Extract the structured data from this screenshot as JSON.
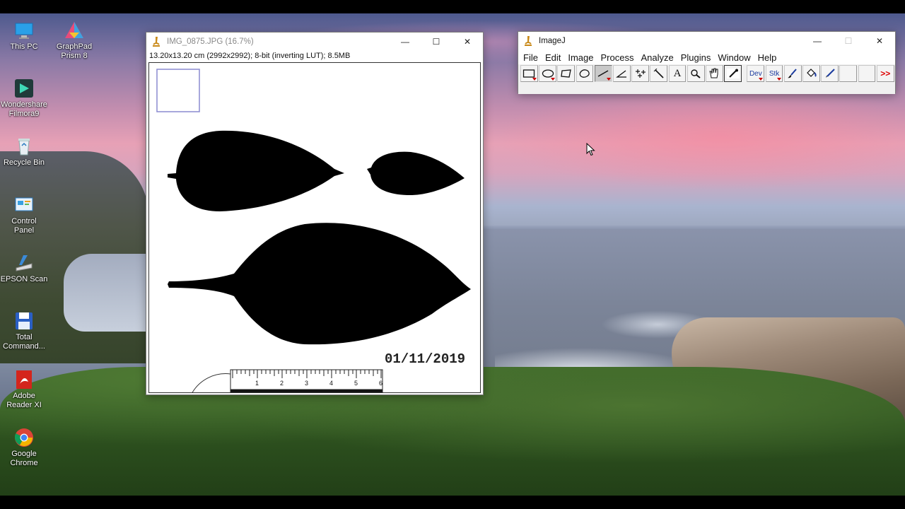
{
  "desktop": {
    "icons": [
      {
        "name": "this-pc",
        "label": "This PC"
      },
      {
        "name": "graphpad-prism",
        "label": "GraphPad\nPrism 8"
      },
      {
        "name": "wondershare-filmora",
        "label": "Wondershare\nFilmora9"
      },
      {
        "name": "recycle-bin",
        "label": "Recycle Bin"
      },
      {
        "name": "control-panel",
        "label": "Control\nPanel"
      },
      {
        "name": "epson-scan",
        "label": "EPSON Scan"
      },
      {
        "name": "total-commander",
        "label": "Total\nCommand..."
      },
      {
        "name": "adobe-reader",
        "label": "Adobe\nReader XI"
      },
      {
        "name": "google-chrome",
        "label": "Google\nChrome"
      }
    ]
  },
  "image_window": {
    "title": "IMG_0875.JPG (16.7%)",
    "info": "13.20x13.20 cm (2992x2992); 8-bit (inverting LUT); 8.5MB",
    "date_stamp": "01/11/2019",
    "ruler_numbers": [
      "1",
      "2",
      "3",
      "4",
      "5",
      "6"
    ],
    "controls": {
      "minimize": "—",
      "maximize": "☐",
      "close": "✕"
    }
  },
  "imagej_window": {
    "title": "ImageJ",
    "menu": [
      "File",
      "Edit",
      "Image",
      "Process",
      "Analyze",
      "Plugins",
      "Window",
      "Help"
    ],
    "tools": [
      {
        "name": "rectangle-tool",
        "icon": "rectangle-icon"
      },
      {
        "name": "oval-tool",
        "icon": "oval-icon"
      },
      {
        "name": "polygon-tool",
        "icon": "polygon-icon"
      },
      {
        "name": "freehand-tool",
        "icon": "freehand-icon"
      },
      {
        "name": "line-tool",
        "icon": "line-icon",
        "selected": true
      },
      {
        "name": "angle-tool",
        "icon": "angle-icon"
      },
      {
        "name": "multipoint-tool",
        "icon": "multipoint-icon"
      },
      {
        "name": "wand-tool",
        "icon": "wand-icon"
      },
      {
        "name": "text-tool",
        "icon": "text-icon",
        "glyph": "A"
      },
      {
        "name": "magnifier-tool",
        "icon": "magnifier-icon"
      },
      {
        "name": "hand-tool",
        "icon": "hand-icon"
      },
      {
        "name": "color-picker-tool",
        "icon": "dropper-icon"
      }
    ],
    "tools_right": {
      "dev": "Dev",
      "stk": "Stk",
      "more": ">>"
    },
    "controls": {
      "minimize": "—",
      "maximize": "☐",
      "close": "✕"
    }
  }
}
